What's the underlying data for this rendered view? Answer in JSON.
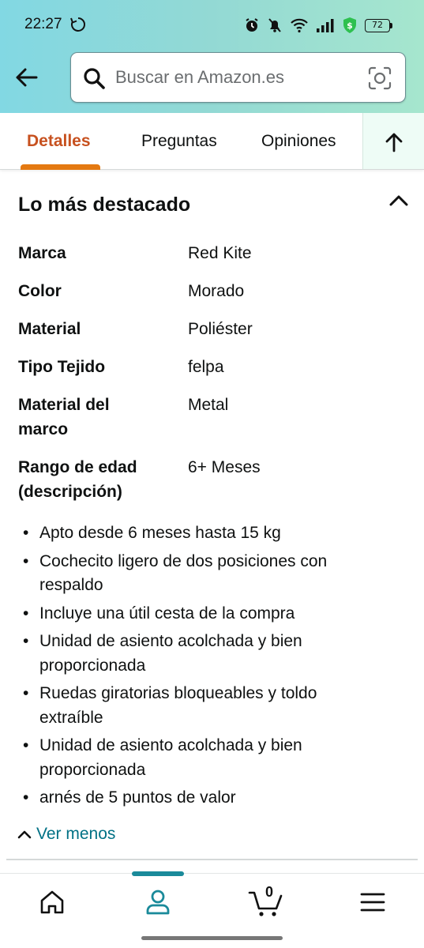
{
  "status_bar": {
    "time": "22:27",
    "battery": "72",
    "icons": [
      "sync-icon",
      "alarm-icon",
      "mute-icon",
      "wifi-icon",
      "signal-icon",
      "security-shield-icon",
      "battery-icon"
    ]
  },
  "header": {
    "search_placeholder": "Buscar en Amazon.es",
    "back_icon": "back-arrow-icon",
    "search_icon": "search-icon",
    "camera_icon": "camera-lens-icon"
  },
  "tabs": {
    "items": [
      {
        "label": "Detalles",
        "active": true
      },
      {
        "label": "Preguntas",
        "active": false
      },
      {
        "label": "Opiniones",
        "active": false
      }
    ],
    "scroll_top_icon": "arrow-up-icon"
  },
  "highlights": {
    "title": "Lo más destacado",
    "specs": [
      {
        "key": "Marca",
        "value": "Red Kite"
      },
      {
        "key": "Color",
        "value": "Morado"
      },
      {
        "key": "Material",
        "value": "Poliéster"
      },
      {
        "key": "Tipo Tejido",
        "value": "felpa"
      },
      {
        "key": "Material del marco",
        "value": "Metal"
      },
      {
        "key": "Rango de edad (descripción)",
        "value": "6+ Meses"
      }
    ],
    "bullets": [
      "Apto desde 6 meses hasta 15 kg",
      "Cochecito ligero de dos posiciones con respaldo",
      "Incluye una útil cesta de la compra",
      "Unidad de asiento acolchada y bien proporcionada",
      "Ruedas giratorias bloqueables y toldo extraíble",
      "Unidad de asiento acolchada y bien proporcionada",
      "arnés de 5 puntos de valor"
    ],
    "see_less": "Ver menos"
  },
  "bottom_nav": {
    "items": [
      "home-icon",
      "account-icon",
      "cart-icon",
      "menu-icon"
    ],
    "active": "account-icon",
    "cart_count": "0"
  },
  "colors": {
    "accent_tab": "#c7511f",
    "tab_underline": "#e47911",
    "link": "#007185",
    "nav_active": "#1a8a9a"
  }
}
